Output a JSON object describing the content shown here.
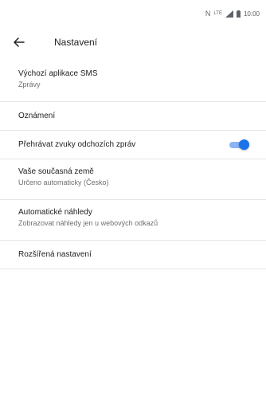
{
  "status_bar": {
    "time": "10:00",
    "network": "LTE"
  },
  "header": {
    "title": "Nastavení",
    "back_icon": "arrow-back-icon"
  },
  "settings": {
    "default_sms": {
      "title": "Výchozí aplikace SMS",
      "subtitle": "Zprávy"
    },
    "notifications": {
      "title": "Oznámení"
    },
    "outgoing_sounds": {
      "title": "Přehrávat zvuky odchozích zpráv",
      "enabled": true
    },
    "country": {
      "title": "Vaše současná země",
      "subtitle": "Určeno automaticky (Česko)"
    },
    "previews": {
      "title": "Automatické náhledy",
      "subtitle": "Zobrazovat náhledy jen u webových odkazů"
    },
    "advanced": {
      "title": "Rozšířená nastavení"
    }
  },
  "colors": {
    "accent": "#1a73e8",
    "accent_track": "#8ab4f8"
  }
}
